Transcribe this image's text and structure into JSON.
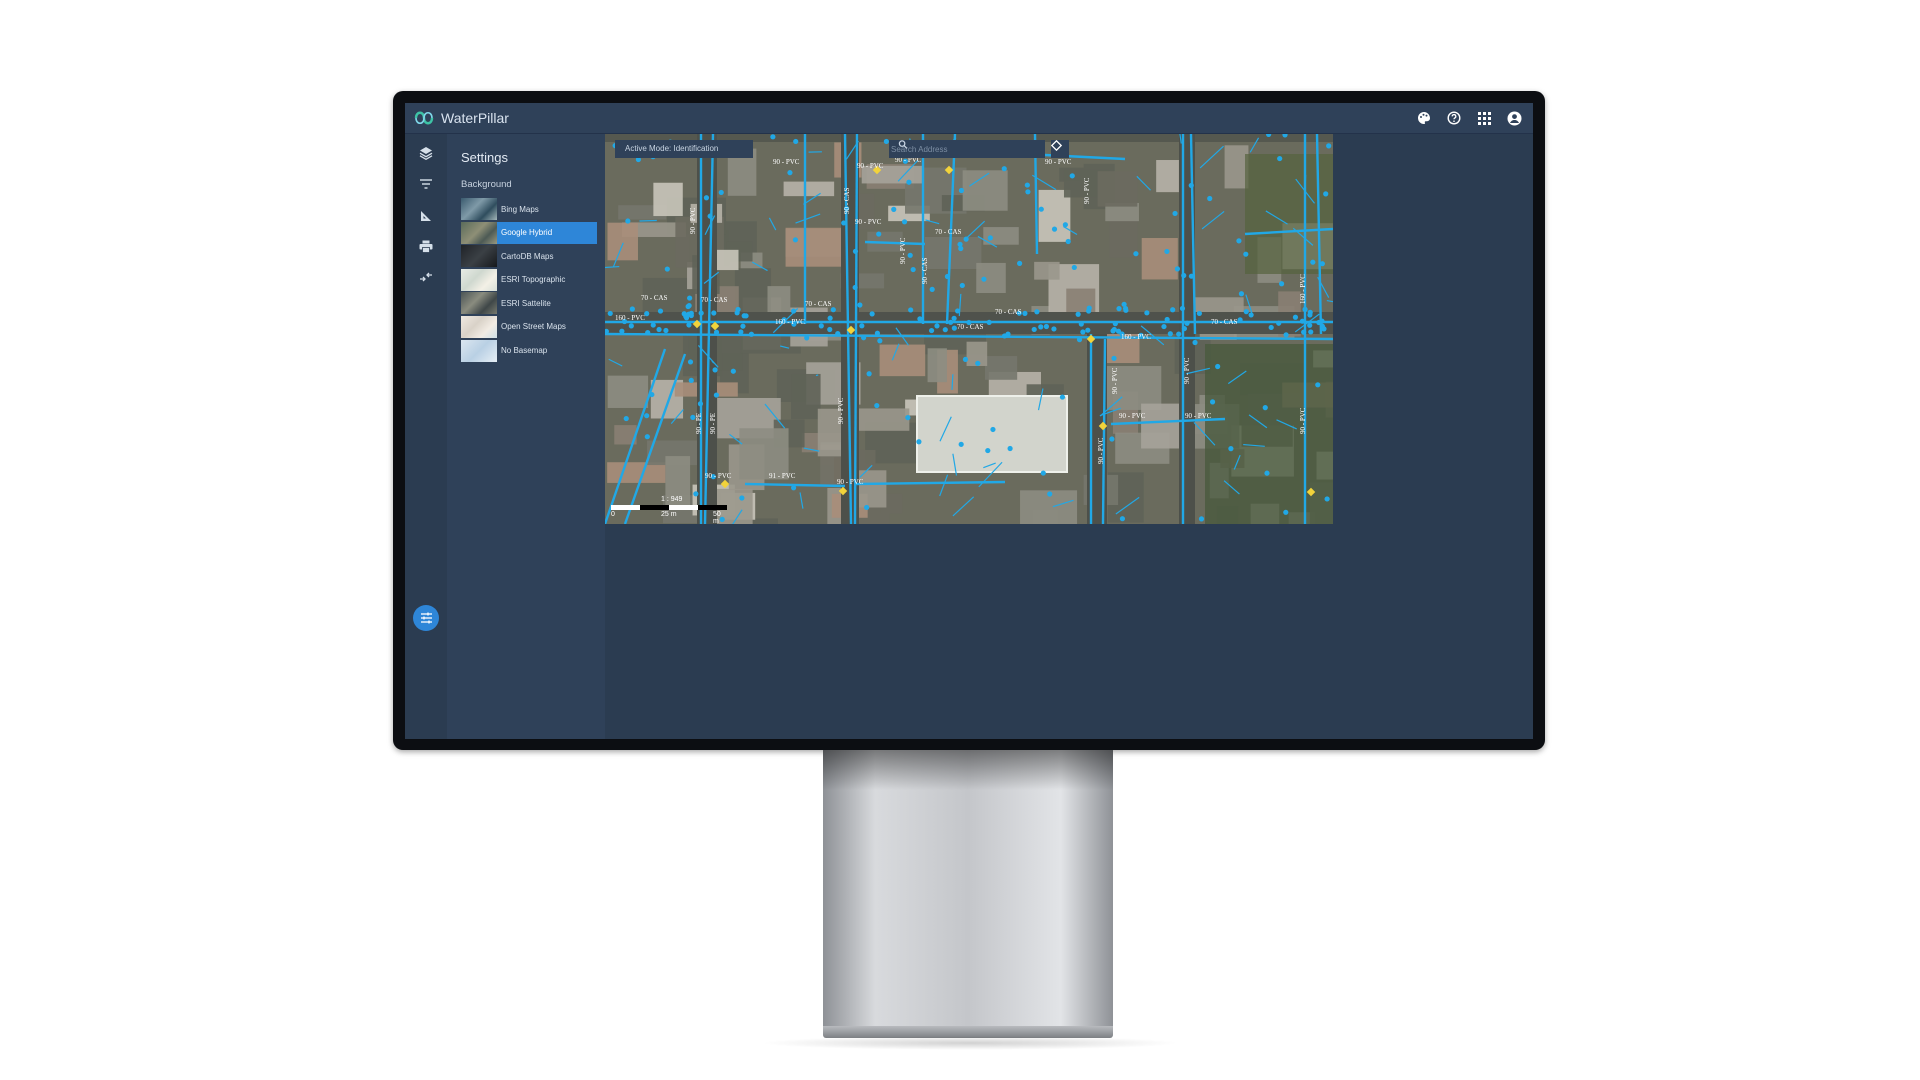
{
  "app": {
    "name": "WaterPillar"
  },
  "topbar": {
    "icons": [
      "palette-icon",
      "help-icon",
      "apps-grid-icon",
      "account-icon"
    ]
  },
  "rail": {
    "icons": [
      "layers-icon",
      "filter-icon",
      "measure-icon",
      "print-icon",
      "compare-icon"
    ],
    "fab_icon": "tune-icon"
  },
  "settings": {
    "title": "Settings",
    "section": "Background",
    "basemaps": [
      {
        "label": "Bing Maps",
        "thumb": "t-bing",
        "selected": false
      },
      {
        "label": "Google Hybrid",
        "thumb": "t-google",
        "selected": true
      },
      {
        "label": "CartoDB Maps",
        "thumb": "t-carto",
        "selected": false
      },
      {
        "label": "ESRI Topographic",
        "thumb": "t-topo",
        "selected": false
      },
      {
        "label": "ESRI Sattelite",
        "thumb": "t-sat",
        "selected": false
      },
      {
        "label": "Open Street Maps",
        "thumb": "t-osm",
        "selected": false
      },
      {
        "label": "No Basemap",
        "thumb": "t-none",
        "selected": false
      }
    ]
  },
  "map": {
    "active_mode": "Active Mode: Identification",
    "search_placeholder": "Search Address",
    "scale_ratio": "1 : 949",
    "scale_labels": [
      "0",
      "25 m",
      "50 m"
    ],
    "pipe_labels": [
      "160 - PVC",
      "70 - CAS",
      "90 - PVC",
      "90 - CAS",
      "90 - PE",
      "91 - PVC"
    ]
  },
  "colors": {
    "accent": "#2e86d8",
    "pipe": "#21a8e6",
    "valve": "#f2d33b",
    "panel": "#2f4159",
    "background": "#2b3c51"
  }
}
